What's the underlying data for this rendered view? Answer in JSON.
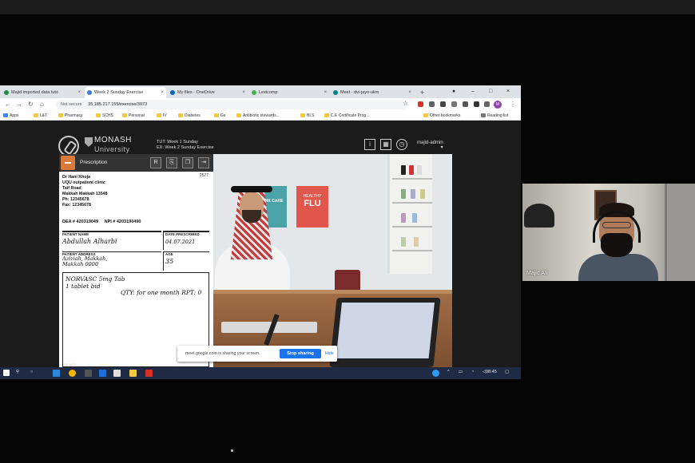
{
  "browser": {
    "tabs": [
      {
        "label": "Majid imported data tuto",
        "color": "#1e8e3e"
      },
      {
        "label": "Week 2 Sunday Exercise",
        "color": "#3c7dd9"
      },
      {
        "label": "My files - OneDrive",
        "color": "#0364b8"
      },
      {
        "label": "Lexicomp",
        "color": "#4caf50"
      },
      {
        "label": "Meet - dvi-jayo-ukm",
        "color": "#00897b"
      }
    ],
    "new_tab": "+",
    "security_label": "Not secure",
    "url": "35.185.217.155/exercise/3073",
    "avatar_initial": "M",
    "bookmarks": [
      "Apps",
      "L&T",
      "Pharmacy",
      "SCHS",
      "Personal",
      "IV",
      "Diabetes",
      "Gx",
      "Antibiotic stewards...",
      "BLS",
      "C.E Certificate Prog..."
    ],
    "other_bookmarks": "Other bookmarks",
    "reading_list": "Reading list"
  },
  "app": {
    "brand_top": "MONASH",
    "brand_bottom": "University",
    "exercise_line1": "TUT: Week 1 Sunday",
    "exercise_line2": "EX: Week 2 Sunday Exercise",
    "user": "majid-admin",
    "user_caret": "▾"
  },
  "prescription": {
    "title": "Prescription",
    "number": "2577",
    "doctor": "Dr Hani Khoja",
    "clinic": "UQU outpatient clinic",
    "road": "Taif Road",
    "city": "Makkah Makkah 13548",
    "ph": "Ph: 12345678",
    "fax": "Fax: 12345678",
    "dea": "DEA # 420319049",
    "npi": "NPI # 4203190490",
    "patient_name_label": "PATIENT NAME",
    "patient_name": "Abdullah Alharbi",
    "date_label": "DATE PRESCRIBED",
    "date": "04.07.2021",
    "address_label": "PATIENT ADDRESS",
    "address_line1": "Aziziah, Makkah,",
    "address_line2": "Makkah 0000",
    "age_label": "AGE",
    "age": "35",
    "rx_line1": "NORVASC 5mg Tab",
    "rx_line2": "1 tablet bid",
    "rx_qty": "QTY: for one month RPT: 0",
    "footer": "DEA#07"
  },
  "scene": {
    "poster1": "THINK CARE",
    "poster2_top": "HEALTHY",
    "poster2_main": "FLU"
  },
  "sharebar": {
    "message": "meet.google.com is sharing your screen.",
    "stop": "Stop sharing",
    "hide": "Hide"
  },
  "taskbar": {
    "time": "08:45"
  },
  "webcam": {
    "name": "Majid Ali"
  }
}
